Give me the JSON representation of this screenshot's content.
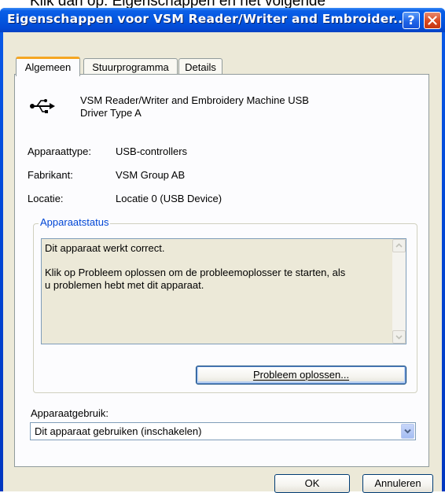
{
  "background_text": "Klik dan op: Eigenschappen en het volgende",
  "window": {
    "title": "Eigenschappen voor VSM Reader/Writer and Embroider...",
    "help_label": "?"
  },
  "tabs": [
    {
      "label": "Algemeen",
      "active": true
    },
    {
      "label": "Stuurprogramma",
      "active": false
    },
    {
      "label": "Details",
      "active": false
    }
  ],
  "device": {
    "icon": "usb-icon",
    "name_line1": "VSM Reader/Writer and Embroidery Machine USB",
    "name_line2": "Driver Type A"
  },
  "properties": [
    {
      "label": "Apparaattype:",
      "value": "USB-controllers"
    },
    {
      "label": "Fabrikant:",
      "value": "VSM Group AB"
    },
    {
      "label": "Locatie:",
      "value": "Locatie 0 (USB Device)"
    }
  ],
  "status": {
    "group_label": "Apparaatstatus",
    "line1": "Dit apparaat werkt correct.",
    "line2": "Klik op Probleem oplossen om de probleemoplosser te starten, als",
    "line3": "u problemen hebt met dit apparaat.",
    "troubleshoot_label": "Probleem oplossen..."
  },
  "usage": {
    "label": "Apparaatgebruik:",
    "selected": "Dit apparaat gebruiken (inschakelen)"
  },
  "buttons": {
    "ok": "OK",
    "cancel": "Annuleren"
  },
  "colors": {
    "titlebar": "#0356df",
    "client": "#ece9d8",
    "groupbox_label": "#0046d5",
    "active_tab_accent": "#f5a623"
  }
}
